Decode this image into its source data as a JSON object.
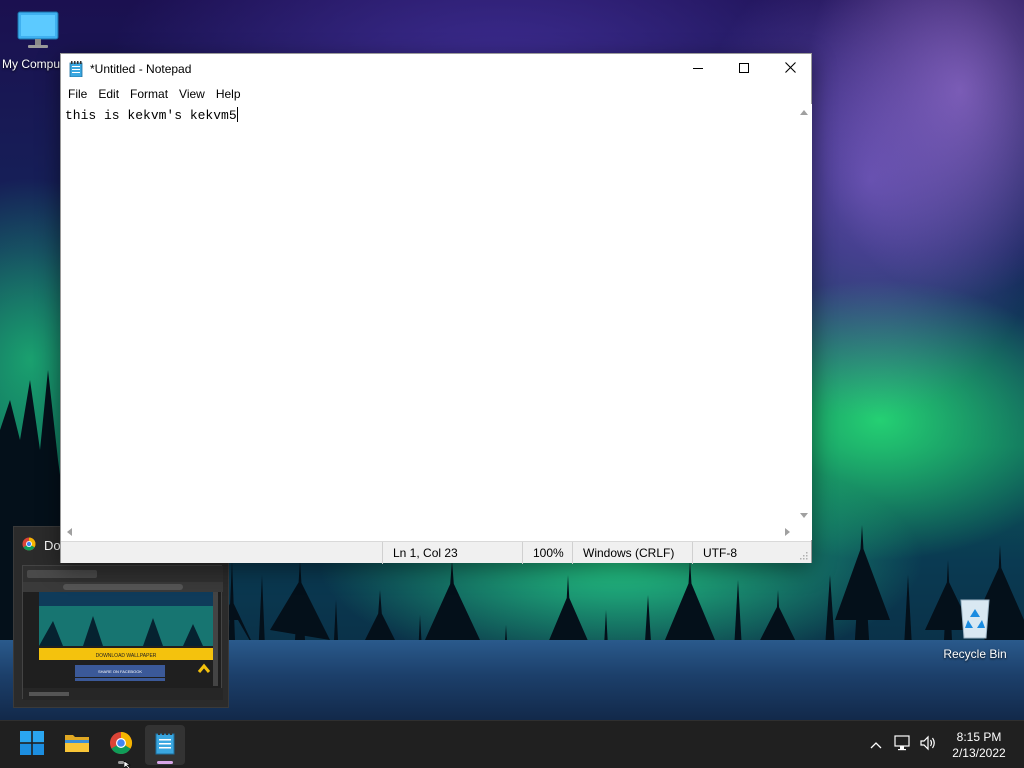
{
  "desktop": {
    "icons": [
      {
        "label": "My Computer",
        "icon": "monitor-icon"
      },
      {
        "label": "Recycle Bin",
        "icon": "recycle-bin-icon"
      }
    ]
  },
  "chrome_preview": {
    "title": "Do",
    "icon": "chrome-icon",
    "thumbnail_texts": {
      "button1": "DOWNLOAD WALLPAPER",
      "button2": "SHARE ON FACEBOOK"
    }
  },
  "notepad": {
    "title": "*Untitled - Notepad",
    "menu": [
      "File",
      "Edit",
      "Format",
      "View",
      "Help"
    ],
    "content": "this is kekvm's kekvm5",
    "status": {
      "position": "Ln 1, Col 23",
      "zoom": "100%",
      "line_ending": "Windows (CRLF)",
      "encoding": "UTF-8"
    }
  },
  "taskbar": {
    "apps": [
      {
        "name": "start",
        "icon": "windows-logo-icon"
      },
      {
        "name": "file-explorer",
        "icon": "folder-icon"
      },
      {
        "name": "chrome",
        "icon": "chrome-icon"
      },
      {
        "name": "notepad",
        "icon": "notepad-icon"
      }
    ],
    "tray": {
      "time": "8:15 PM",
      "date": "2/13/2022"
    }
  },
  "colors": {
    "taskbar_bg": "#202020",
    "windows_blue": "#0078d4",
    "folder_yellow": "#f8c537",
    "notepad_active_indicator": "#d7a6e8"
  }
}
